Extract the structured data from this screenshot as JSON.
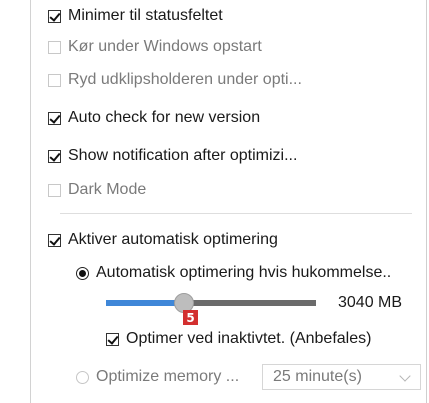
{
  "settings": {
    "minimize_to_tray": "Minimer til statusfeltet",
    "run_on_startup": "Kør under Windows opstart",
    "clear_clipboard": "Ryd udklipsholderen under opti...",
    "auto_check_update": "Auto check for new version",
    "show_notification": "Show notification after optimizi...",
    "dark_mode": "Dark Mode"
  },
  "auto_optimization": {
    "enable_label": "Aktiver automatisk optimering",
    "memory_mode_label": "Automatisk optimering hvis hukommelse..",
    "threshold": {
      "value_label": "3040 MB",
      "slider_fraction": 0.36,
      "marker": "5"
    },
    "idle_label": "Optimer ved inaktivtet. (Anbefales)",
    "interval_mode_label": "Optimize memory ...",
    "interval_value": "25 minute(s)"
  },
  "states": {
    "minimize_to_tray": true,
    "run_on_startup": false,
    "clear_clipboard": false,
    "auto_check_update": true,
    "show_notification": true,
    "dark_mode": false,
    "enable_auto": true,
    "memory_mode_selected": true,
    "idle_optimize": true,
    "interval_mode_selected": false
  },
  "colors": {
    "slider_fill": "#3f87d8",
    "slider_rest": "#6b6b6b",
    "badge": "#d32f2f"
  }
}
